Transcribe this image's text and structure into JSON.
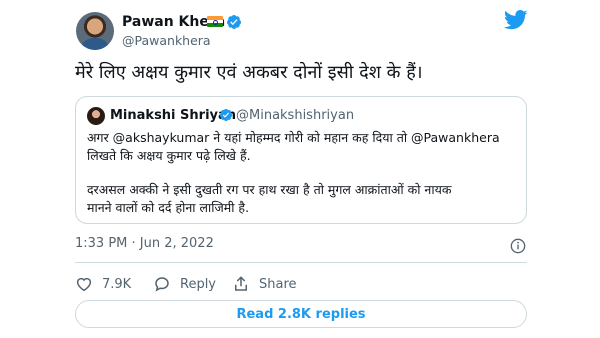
{
  "tweet": {
    "author_name": "Pawan Khera",
    "author_handle": "@Pawankhera",
    "text": "मेरे लिए अक्षय कुमार एवं अकबर दोनों इसी देश के हैं।",
    "timestamp": "1:33 PM · Jun 2, 2022"
  },
  "quote": {
    "author_name": "Minakshi Shriyan",
    "author_handle": "@Minakshishriyan",
    "line1": "अगर @akshaykumar ने यहां मोहम्मद गोरी को महान कह दिया तो @Pawankhera",
    "line2": "लिखते कि अक्षय कुमार पढ़े लिखे हैं.",
    "line3": "दरअसल अक्की ने इसी दुखती रग पर हाथ रखा है तो मुगल आक्रांताओं को नायक",
    "line4": "मानने वालों को दर्द होना लाजिमी है."
  },
  "actions": {
    "like_count": "7.9K",
    "reply_label": "Reply",
    "share_label": "Share"
  },
  "replies_button": "Read 2.8K replies",
  "colors": {
    "accent": "#1d9bf0",
    "like_red": "#536471",
    "border": "#cfd9de",
    "secondary_text": "#536471"
  }
}
